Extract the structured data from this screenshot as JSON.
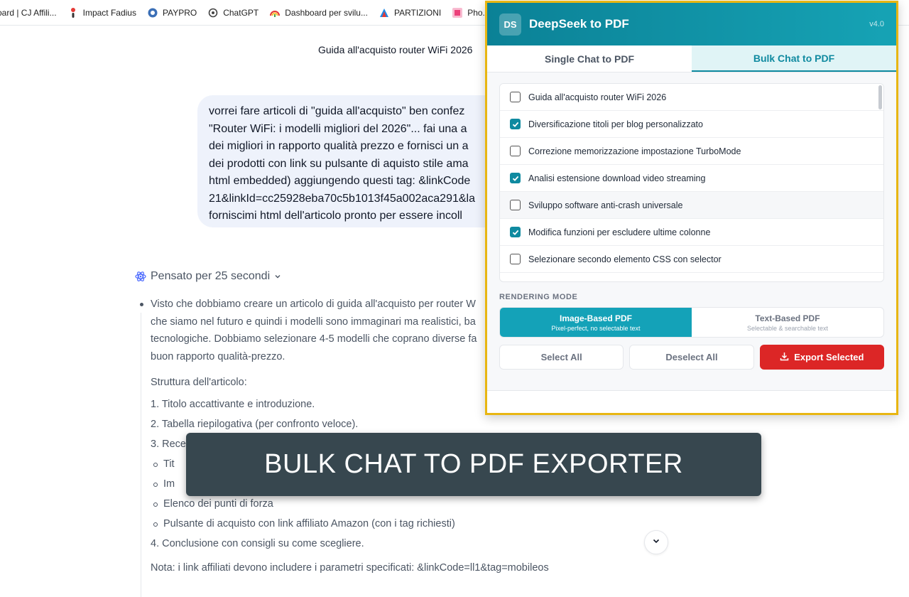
{
  "bookmarks": [
    {
      "label": "oard | CJ Affili...",
      "icon": "page-icon"
    },
    {
      "label": "Impact Fadius",
      "icon": "impact-icon"
    },
    {
      "label": "PAYPRO",
      "icon": "paypro-icon"
    },
    {
      "label": "ChatGPT",
      "icon": "chatgpt-icon"
    },
    {
      "label": "Dashboard per svilu...",
      "icon": "dashboard-icon"
    },
    {
      "label": "PARTIZIONI",
      "icon": "partition-icon"
    },
    {
      "label": "Pho.to",
      "icon": "photo-icon"
    }
  ],
  "chat": {
    "title": "Guida all'acquisto router WiFi 2026",
    "user_message_lines": [
      "vorrei fare articoli di \"guida all'acquisto\" ben confez",
      "\"Router WiFi: i modelli migliori del 2026\"... fai una a",
      "dei migliori in rapporto qualità prezzo e fornisci un a",
      "dei prodotti con link su pulsante di aquisto stile ama",
      "html embedded) aggiungendo questi tag: &linkCode",
      "21&linkId=cc25928eba70c5b1013f45a002aca291&la",
      "forniscimi html dell'articolo pronto per essere incoll"
    ],
    "thought_label": "Pensato per 25 secondi",
    "reasoning_lines": [
      "Visto che dobbiamo creare un articolo di guida all'acquisto per router W",
      "che siamo nel futuro e quindi i modelli sono immaginari ma realistici, ba",
      "tecnologiche. Dobbiamo selezionare 4-5 modelli che coprano diverse fa",
      "buon rapporto qualità-prezzo."
    ],
    "structure_heading": "Struttura dell'articolo:",
    "ordered": [
      "1. Titolo accattivante e introduzione.",
      "2. Tabella riepilogativa (per confronto veloce).",
      "3. Rece"
    ],
    "sub_items": [
      "Tit",
      "Im",
      "Elenco dei punti di forza",
      "Pulsante di acquisto con link affiliato Amazon (con i tag richiesti)"
    ],
    "ordered_last": "4. Conclusione con consigli su come scegliere.",
    "note_partial": "Nota: i link affiliati devono includere i parametri specificati: &linkCode=ll1&tag=mobileos"
  },
  "banner": {
    "text": "BULK CHAT TO PDF EXPORTER"
  },
  "popup": {
    "logo": "DS",
    "title": "DeepSeek to PDF",
    "version": "v4.0",
    "tabs": [
      {
        "label": "Single Chat to PDF",
        "active": false
      },
      {
        "label": "Bulk Chat to PDF",
        "active": true
      }
    ],
    "chats": [
      {
        "label": "Guida all'acquisto router WiFi 2026",
        "checked": false
      },
      {
        "label": "Diversificazione titoli per blog personalizzato",
        "checked": true
      },
      {
        "label": "Correzione memorizzazione impostazione TurboMode",
        "checked": false
      },
      {
        "label": "Analisi estensione download video streaming",
        "checked": true
      },
      {
        "label": "Sviluppo software anti-crash universale",
        "checked": false
      },
      {
        "label": "Modifica funzioni per escludere ultime colonne",
        "checked": true
      },
      {
        "label": "Selezionare secondo elemento CSS con selector",
        "checked": false
      }
    ],
    "rendering_label": "RENDERING MODE",
    "modes": [
      {
        "title": "Image-Based PDF",
        "subtitle": "Pixel-perfect, no selectable text",
        "active": true
      },
      {
        "title": "Text-Based PDF",
        "subtitle": "Selectable & searchable text",
        "active": false
      }
    ],
    "buttons": {
      "select_all": "Select All",
      "deselect_all": "Deselect All",
      "export": "Export Selected"
    },
    "colors": {
      "accent": "#0f8aa0",
      "export": "#dc2626",
      "frame": "#e8b612"
    }
  }
}
